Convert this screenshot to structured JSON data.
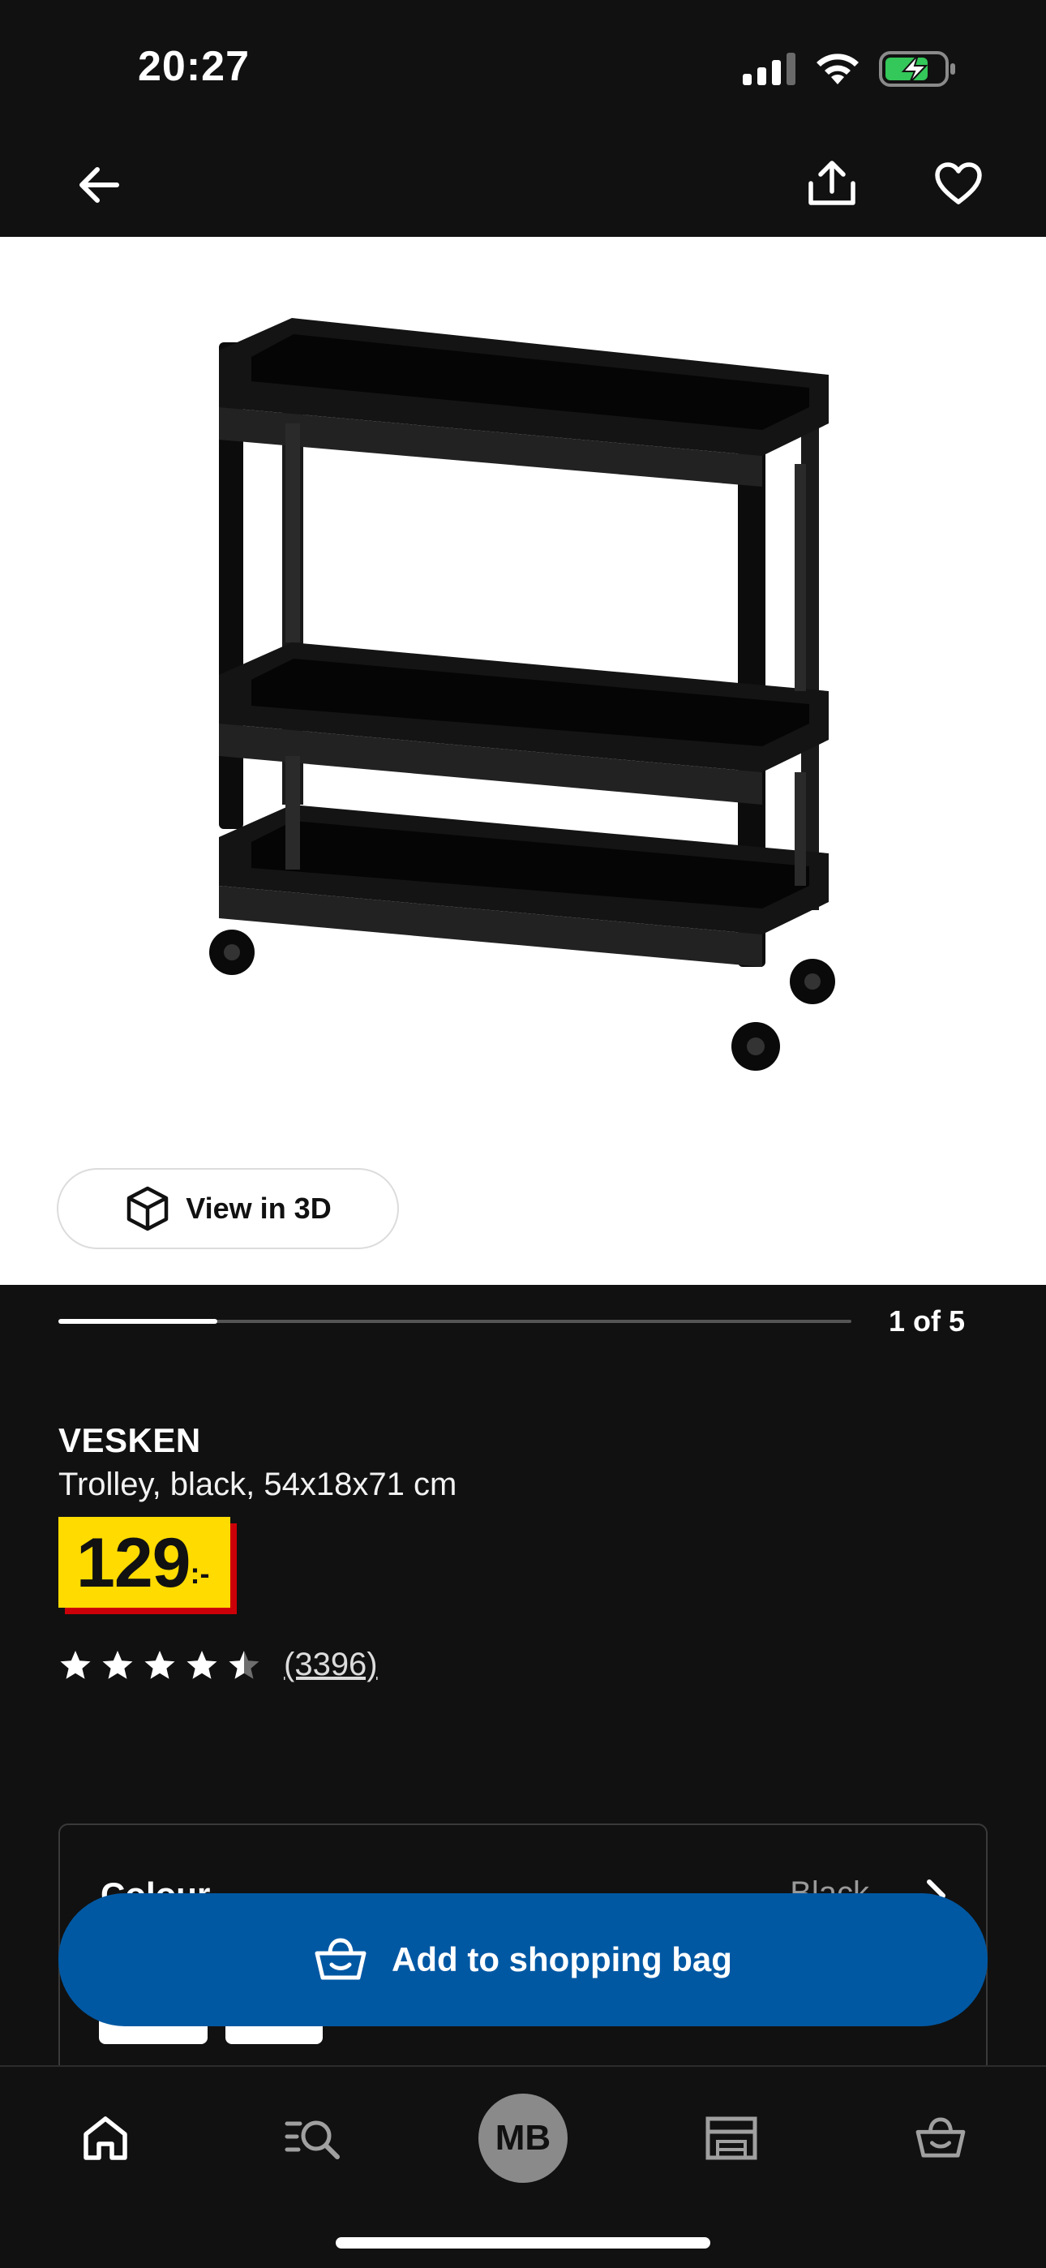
{
  "status_bar": {
    "time": "20:27",
    "icons": [
      "cellular-signal-icon",
      "wifi-icon",
      "battery-charging-icon"
    ],
    "battery_color": "#34c759"
  },
  "top_nav": {
    "back_icon": "arrow-left-icon",
    "share_icon": "share-icon",
    "favourite_icon": "heart-icon"
  },
  "gallery": {
    "view_3d_label": "View in 3D",
    "page_indicator": "1 of 5",
    "current_index": 1,
    "total": 5
  },
  "product": {
    "name": "VESKEN",
    "description": "Trolley, black, 54x18x71 cm",
    "price": {
      "amount": "129",
      "suffix": ":-",
      "background_color": "#ffdb00",
      "shadow_color": "#cc0008"
    },
    "rating": {
      "value": 4.5,
      "max": 5,
      "review_count": "(3396)"
    }
  },
  "colour_section": {
    "label": "Colour",
    "value": "Black"
  },
  "add_to_bag": {
    "label": "Add to shopping bag",
    "color": "#0058a3",
    "icon": "shopping-bag-icon"
  },
  "tab_bar": {
    "items": [
      {
        "name": "home",
        "icon": "home-icon"
      },
      {
        "name": "search",
        "icon": "search-list-icon"
      },
      {
        "name": "profile",
        "avatar_initials": "MB"
      },
      {
        "name": "stores",
        "icon": "store-icon"
      },
      {
        "name": "bag",
        "icon": "shopping-bag-icon"
      }
    ]
  }
}
